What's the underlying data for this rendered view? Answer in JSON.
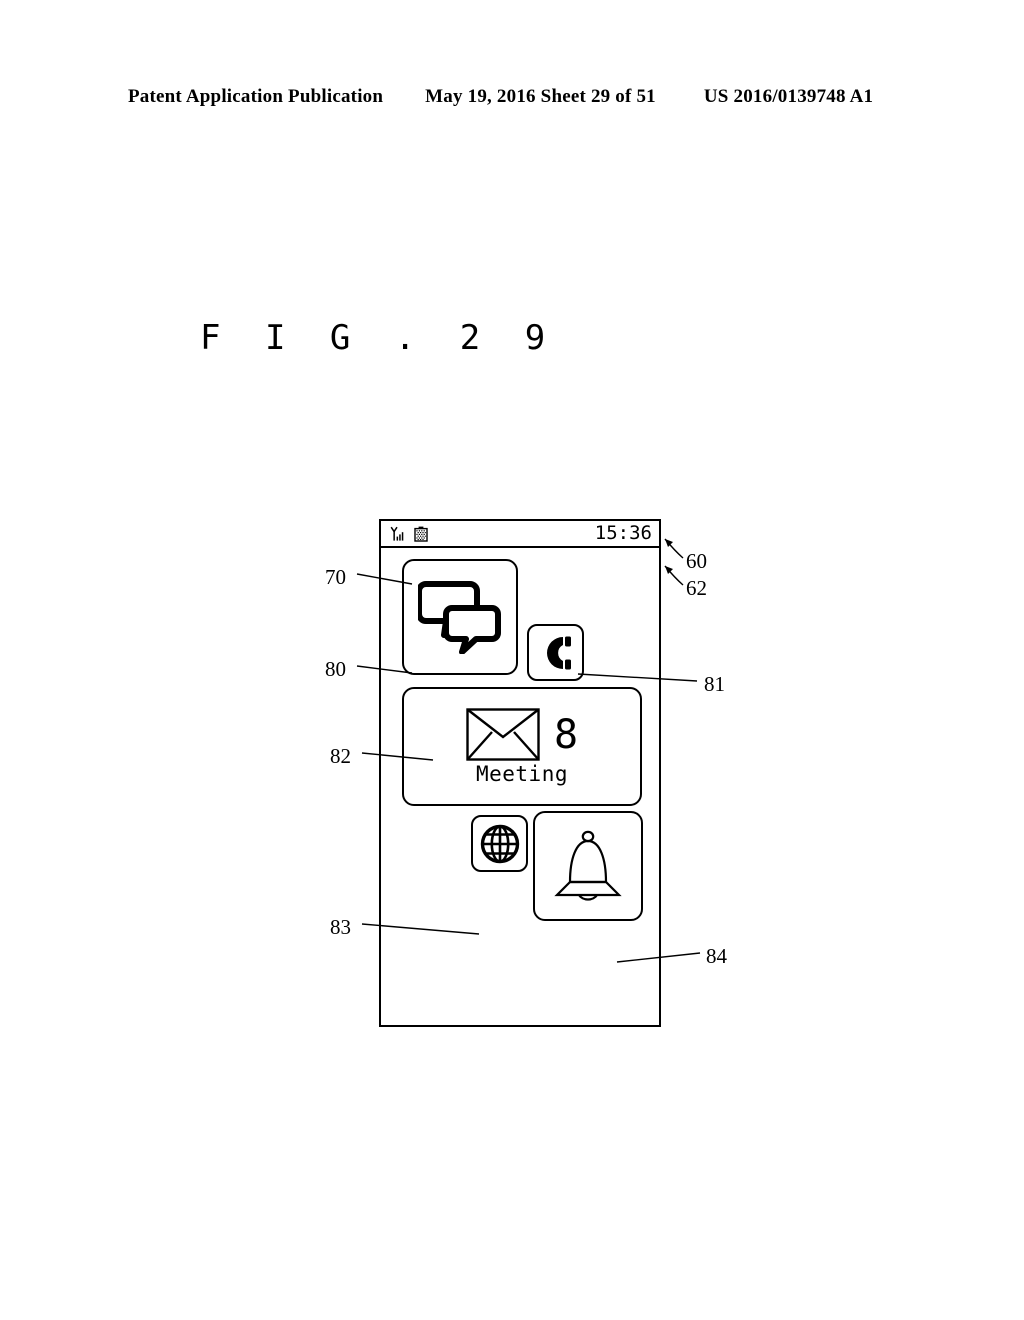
{
  "header": {
    "publication": "Patent Application Publication",
    "date_sheet": "May 19, 2016  Sheet 29 of 51",
    "patent_number": "US 2016/0139748 A1"
  },
  "figure": {
    "title": "F I G .   2 9"
  },
  "device": {
    "status_bar": {
      "signal_icon": "signal-strength-icon",
      "battery_icon": "battery-icon",
      "time": "15:36"
    },
    "tiles": [
      {
        "id": "chat",
        "icon": "speech-bubbles-icon",
        "label": "",
        "badge": ""
      },
      {
        "id": "phone",
        "icon": "telephone-handset-icon",
        "label": "",
        "badge": ""
      },
      {
        "id": "mail",
        "icon": "envelope-icon",
        "label": "Meeting",
        "badge": "8"
      },
      {
        "id": "globe",
        "icon": "globe-icon",
        "label": "",
        "badge": ""
      },
      {
        "id": "bell",
        "icon": "bell-icon",
        "label": "",
        "badge": ""
      }
    ]
  },
  "reference_numerals": {
    "n70": "70",
    "n80": "80",
    "n82": "82",
    "n83": "83",
    "n60": "60",
    "n62": "62",
    "n81": "81",
    "n84": "84"
  },
  "colors": {
    "ink": "#000000",
    "paper": "#ffffff"
  }
}
